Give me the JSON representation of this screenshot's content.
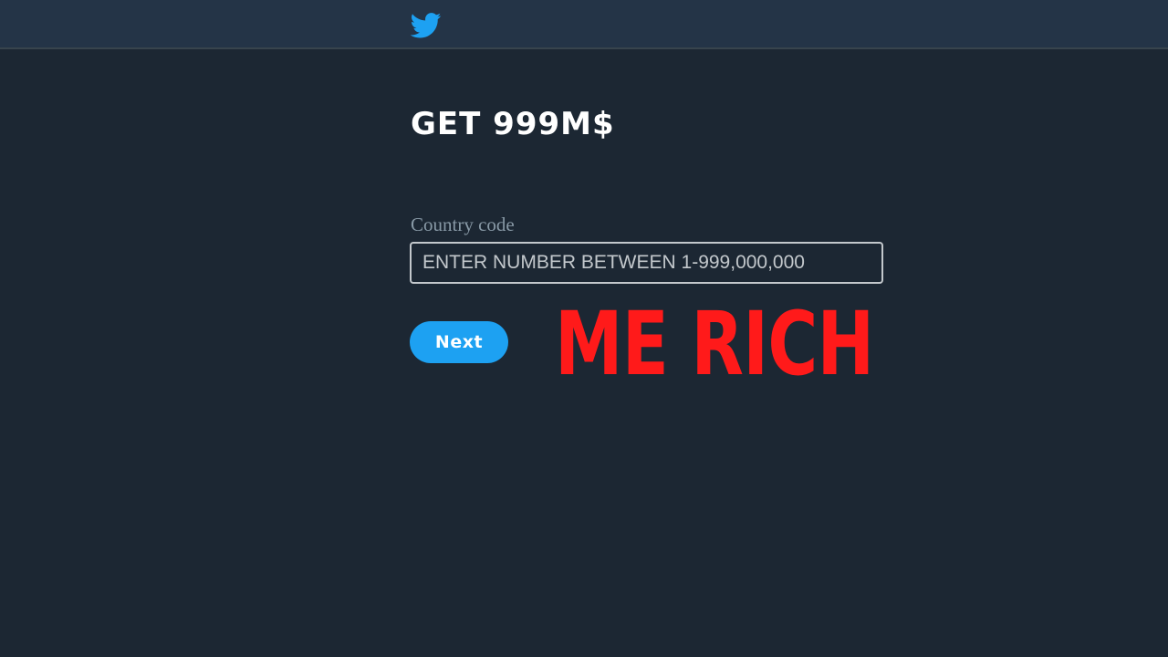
{
  "header": {
    "logo_icon": "twitter-bird-icon",
    "accent_color": "#1da1f2"
  },
  "main": {
    "title": "GET 999M$",
    "field_label": "Country code",
    "input_value": "ENTER NUMBER BETWEEN 1-999,000,000",
    "next_label": "Next"
  },
  "overlay": {
    "text": "ME RICH",
    "color": "#ff1a1a"
  }
}
